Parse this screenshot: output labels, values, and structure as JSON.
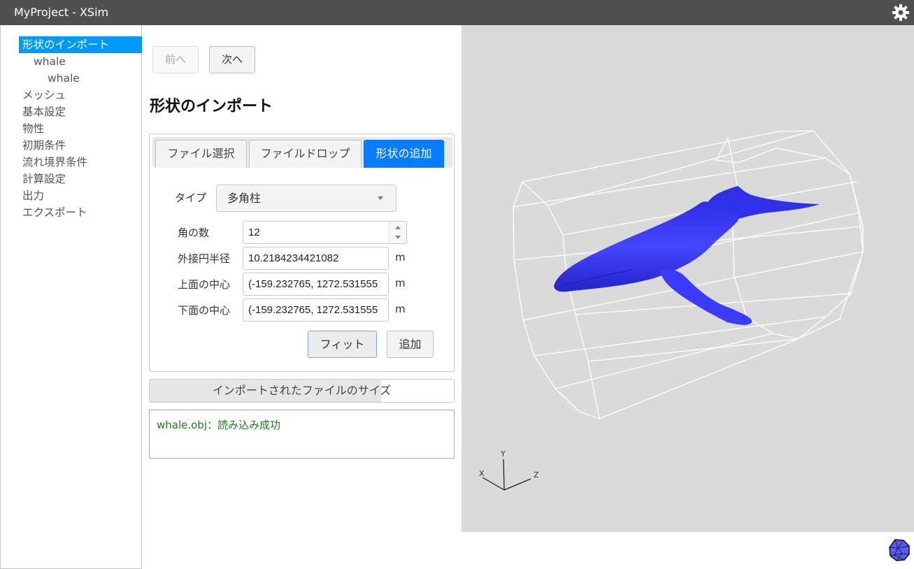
{
  "window": {
    "title": "MyProject - XSim",
    "settings_icon": "gear-icon"
  },
  "sidebar": {
    "items": [
      {
        "label": "形状のインポート",
        "level": 0,
        "active": true
      },
      {
        "label": "whale",
        "level": 1,
        "active": false
      },
      {
        "label": "whale",
        "level": 2,
        "active": false
      },
      {
        "label": "メッシュ",
        "level": 0,
        "active": false
      },
      {
        "label": "基本設定",
        "level": 0,
        "active": false
      },
      {
        "label": "物性",
        "level": 0,
        "active": false
      },
      {
        "label": "初期条件",
        "level": 0,
        "active": false
      },
      {
        "label": "流れ境界条件",
        "level": 0,
        "active": false
      },
      {
        "label": "計算設定",
        "level": 0,
        "active": false
      },
      {
        "label": "出力",
        "level": 0,
        "active": false
      },
      {
        "label": "エクスポート",
        "level": 0,
        "active": false
      }
    ]
  },
  "nav": {
    "prev_label": "前へ",
    "prev_disabled": true,
    "next_label": "次へ"
  },
  "page": {
    "title": "形状のインポート"
  },
  "tabs": [
    {
      "label": "ファイル選択",
      "active": false
    },
    {
      "label": "ファイルドロップ",
      "active": false
    },
    {
      "label": "形状の追加",
      "active": true
    }
  ],
  "form": {
    "type_label": "タイプ",
    "type_value": "多角柱",
    "corners_label": "角の数",
    "corners_value": "12",
    "radius_label": "外接円半径",
    "radius_value": "10.2184234421082",
    "radius_unit": "m",
    "top_center_label": "上面の中心",
    "top_center_value": "(-159.232765, 1272.531555",
    "top_center_unit": "m",
    "bottom_center_label": "下面の中心",
    "bottom_center_value": "(-159.232765, 1272.531555",
    "bottom_center_unit": "m",
    "fit_label": "フィット",
    "add_label": "追加"
  },
  "file_size": {
    "label": "インポートされたファイルのサイズ",
    "progress_percent": 76
  },
  "log": {
    "message": "whale.obj：読み込み成功",
    "color": "#1f7a1f"
  },
  "viewport": {
    "background": "#dadada",
    "model_color": "#3a3aff",
    "wireframe_color": "#ffffff",
    "axes": {
      "x": "X",
      "y": "Y",
      "z": "Z"
    },
    "view_cube_icon": "view-cube-icon"
  },
  "colors": {
    "accent": "#0a7cff",
    "sidebar_active": "#0099ff",
    "titlebar": "#505050"
  }
}
